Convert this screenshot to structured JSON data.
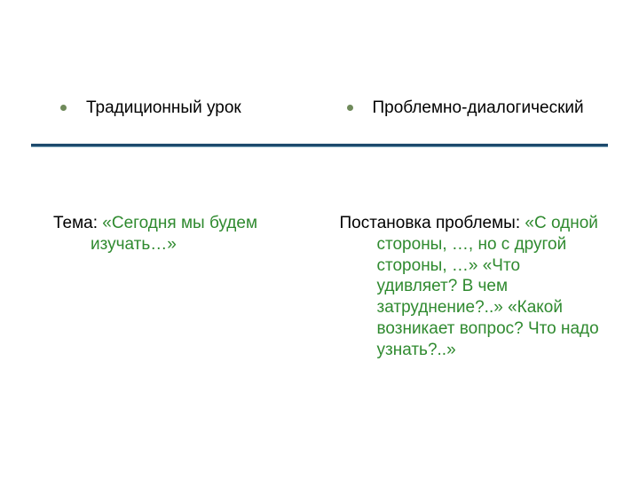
{
  "left": {
    "bullet": "Традиционный урок",
    "label": "Тема:",
    "text": " «Сегодня мы будем изучать…»"
  },
  "right": {
    "bullet": "Проблемно-диалогический",
    "label": "Постановка проблемы:",
    "text": " «С одной стороны, …, но с другой стороны, …» «Что удивляет? В чем затруднение?..» «Какой возникает вопрос? Что надо узнать?..»"
  }
}
